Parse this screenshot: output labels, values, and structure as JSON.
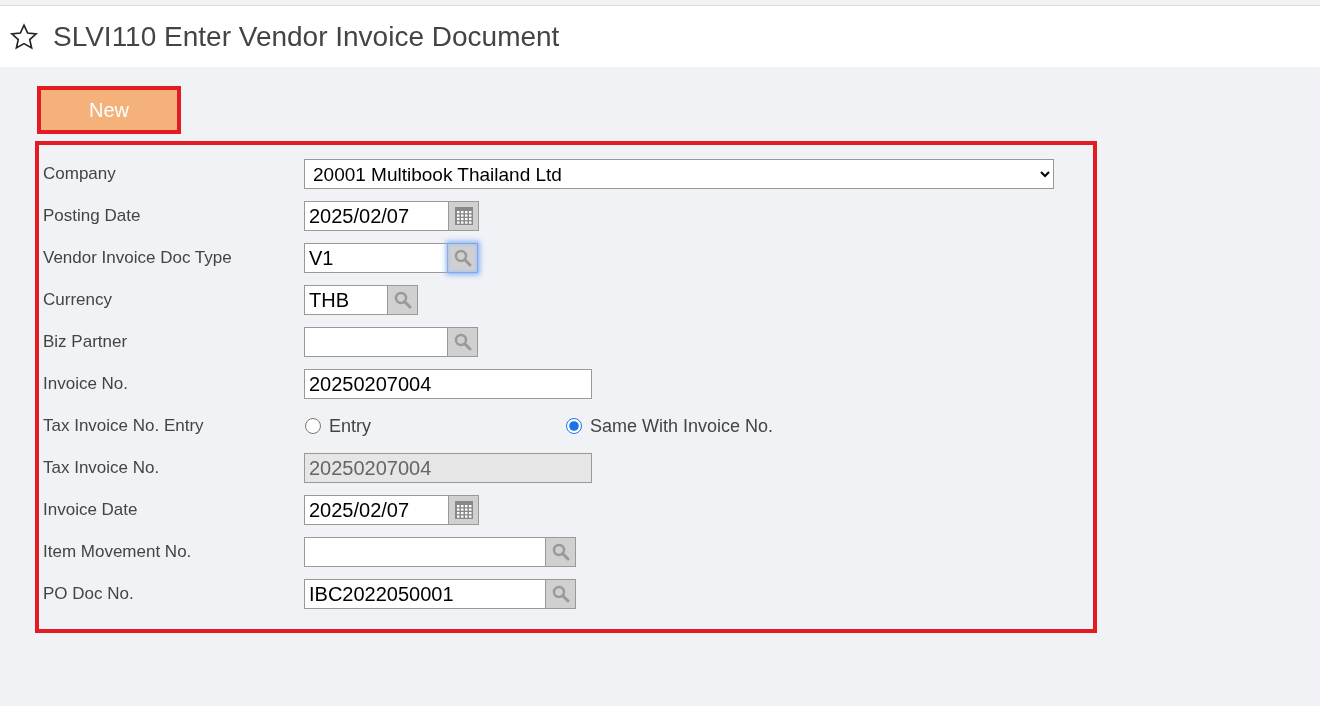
{
  "page": {
    "title": "SLVI110 Enter Vendor Invoice Document"
  },
  "toolbar": {
    "new_button": "New"
  },
  "form": {
    "fields": [
      {
        "kind": "select",
        "label": "Company",
        "value": "20001 Multibook Thailand Ltd",
        "focused": false
      },
      {
        "kind": "date",
        "label": "Posting Date",
        "value": "2025/02/07",
        "focused": false
      },
      {
        "kind": "lookup",
        "label": "Vendor Invoice Doc Type",
        "value": "V1",
        "focused": true
      },
      {
        "kind": "lookup",
        "label": "Currency",
        "value": "THB",
        "focused": false
      },
      {
        "kind": "lookup",
        "label": "Biz Partner",
        "focused": false
      },
      {
        "kind": "text",
        "label": "Invoice No.",
        "value": "20250207004",
        "focused": false
      },
      {
        "kind": "radio",
        "label": "Tax Invoice No. Entry",
        "options": [
          {
            "label": "Entry",
            "selected": false
          },
          {
            "label": "Same With Invoice No.",
            "selected": true
          }
        ],
        "focused": false
      },
      {
        "kind": "disabled",
        "label": "Tax Invoice No.",
        "value": "20250207004",
        "focused": false
      },
      {
        "kind": "date",
        "label": "Invoice Date",
        "value": "2025/02/07",
        "focused": false
      },
      {
        "kind": "lookup",
        "label": "Item Movement No.",
        "focused": false
      },
      {
        "kind": "lookup",
        "label": "PO Doc No.",
        "value": "IBC2022050001",
        "focused": false
      }
    ]
  }
}
